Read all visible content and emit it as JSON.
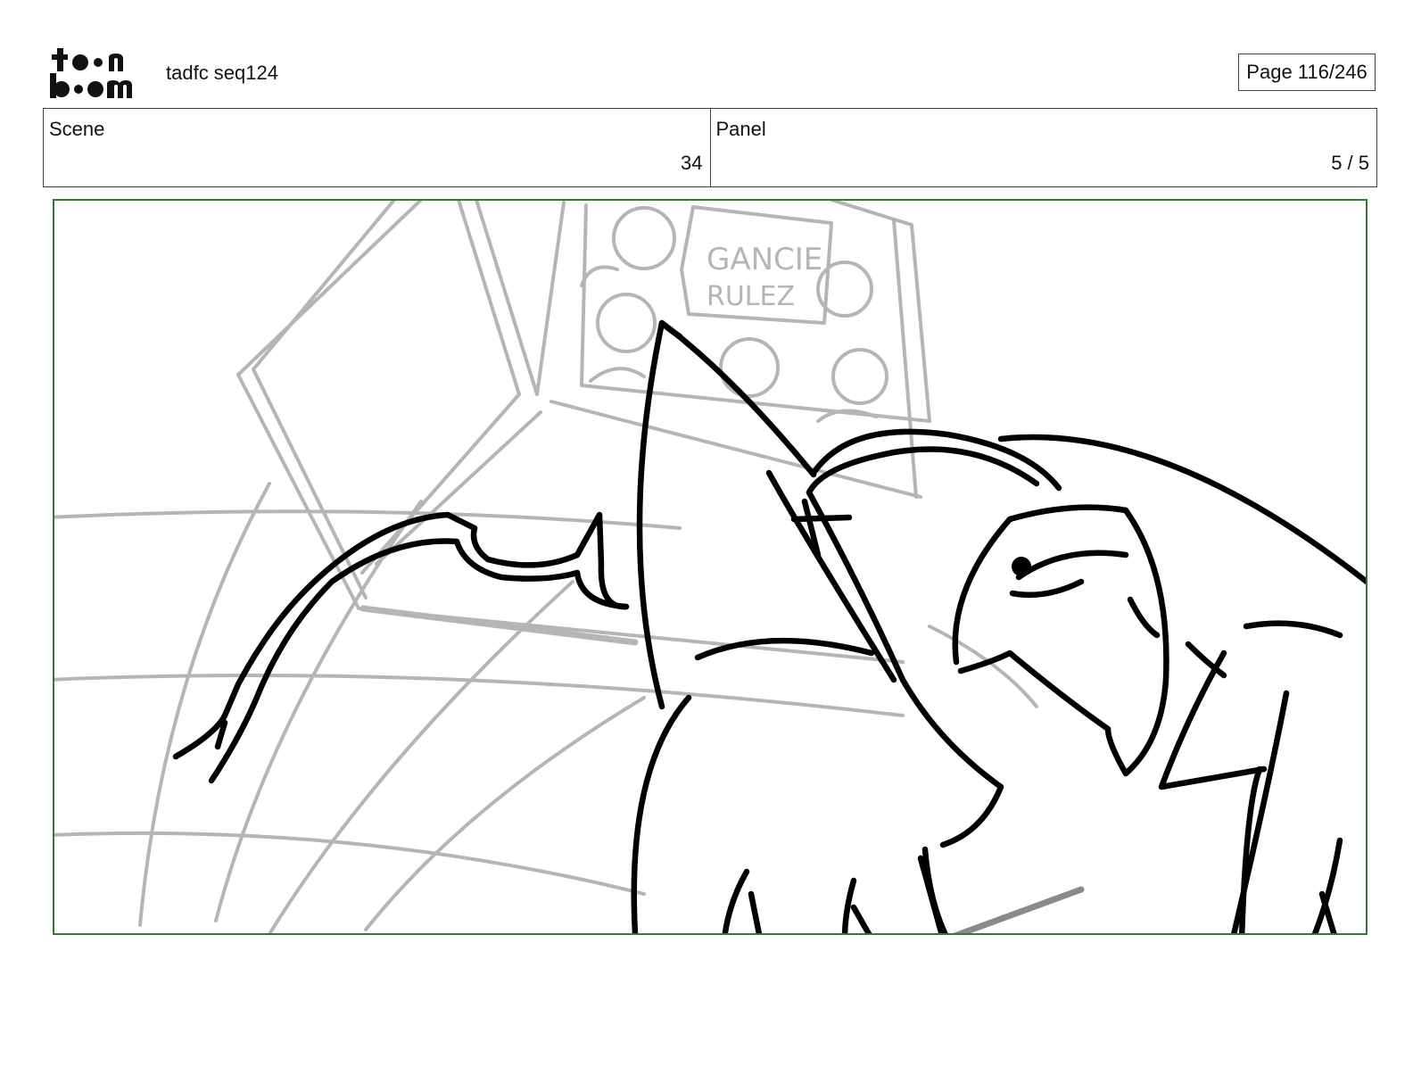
{
  "header": {
    "brand": "toon boom",
    "document_title": "tadfc seq124",
    "page_indicator": "Page 116/246"
  },
  "info": {
    "scene_label": "Scene",
    "scene_value": "34",
    "panel_label": "Panel",
    "panel_value": "5 / 5"
  },
  "drawing": {
    "sign_line_1": "GANCIE",
    "sign_line_2": "RULEZ",
    "frame_color": "#2e7d2e",
    "ink_color": "#000000",
    "rough_color": "#b5b5b5"
  }
}
